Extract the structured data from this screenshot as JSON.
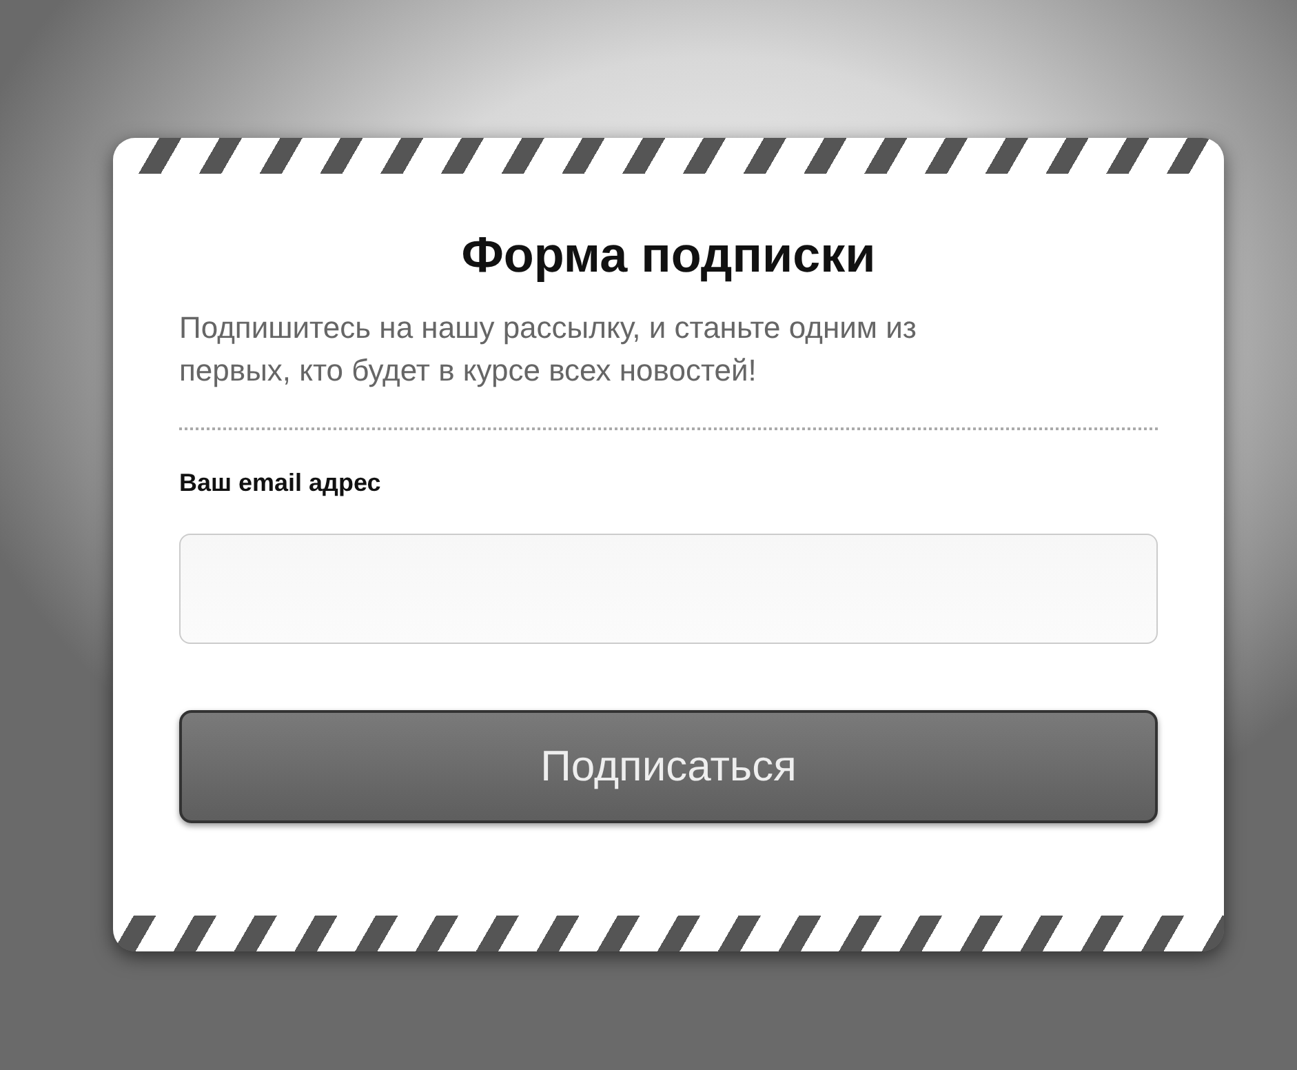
{
  "form": {
    "title": "Форма подписки",
    "description": "Подпишитесь на нашу рассылку, и станьте одним из первых, кто будет в курсе всех новостей!",
    "email_label": "Ваш email адрес",
    "submit_button": "Подписаться"
  }
}
